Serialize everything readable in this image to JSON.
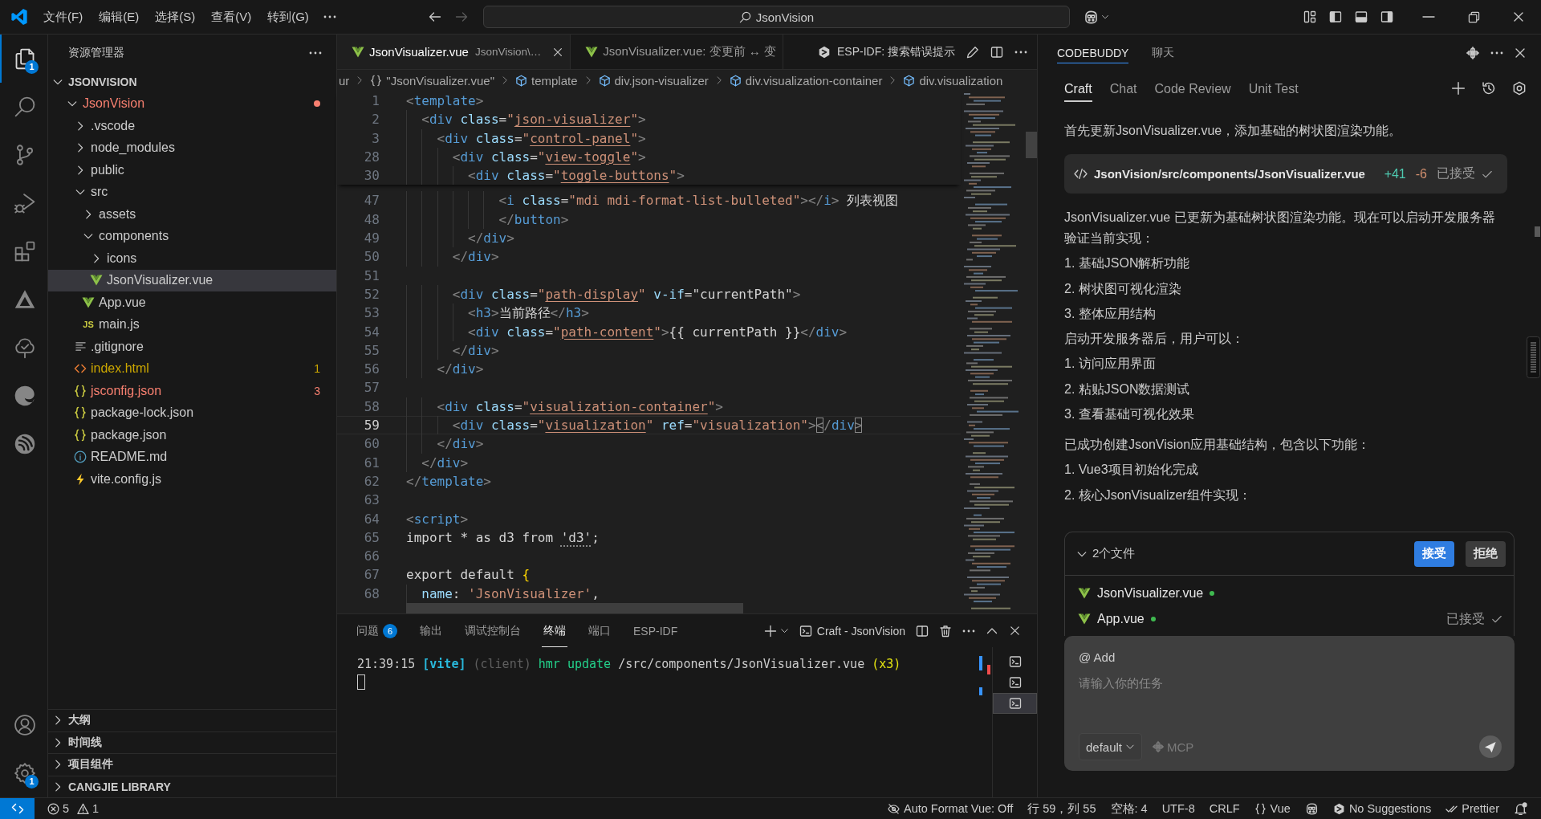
{
  "title_bar": {
    "menus": [
      "文件(F)",
      "编辑(E)",
      "选择(S)",
      "查看(V)",
      "转到(G)"
    ],
    "navigation": [
      {
        "kind": "back",
        "disabled": false
      },
      {
        "kind": "forward",
        "disabled": true
      }
    ],
    "search": {
      "label": "JsonVision"
    }
  },
  "activity_bar": {
    "items": [
      {
        "kind": "explorer",
        "selected": true,
        "badge": "1"
      },
      {
        "kind": "search",
        "selected": false
      },
      {
        "kind": "source-control",
        "selected": false
      },
      {
        "kind": "run-debug",
        "selected": false
      },
      {
        "kind": "extensions",
        "selected": false
      },
      {
        "kind": "triangle",
        "selected": false
      },
      {
        "kind": "tree",
        "selected": false
      },
      {
        "kind": "swirl",
        "selected": false
      },
      {
        "kind": "disc",
        "selected": false
      }
    ],
    "bottom": [
      {
        "kind": "account"
      },
      {
        "kind": "manage",
        "badge": "1"
      }
    ]
  },
  "sidebar": {
    "title": "资源管理器",
    "root": {
      "label": "JSONVISION",
      "expanded": true,
      "children": [
        {
          "label": "JsonVision",
          "kind": "folder",
          "expanded": true,
          "selected": false,
          "color": "#f88070",
          "children": [
            {
              "label": ".vscode",
              "kind": "folder",
              "expanded": false,
              "selected": false
            },
            {
              "label": "node_modules",
              "kind": "folder",
              "expanded": false,
              "selected": false
            },
            {
              "label": "public",
              "kind": "folder",
              "expanded": false,
              "selected": false
            },
            {
              "label": "src",
              "kind": "folder",
              "expanded": true,
              "selected": false,
              "children": [
                {
                  "label": "assets",
                  "kind": "folder",
                  "expanded": false,
                  "selected": false
                },
                {
                  "label": "components",
                  "kind": "folder",
                  "expanded": true,
                  "selected": false,
                  "children": [
                    {
                      "label": "icons",
                      "kind": "folder",
                      "expanded": false,
                      "selected": false
                    },
                    {
                      "label": "JsonVisualizer.vue",
                      "kind": "vue",
                      "selected": true
                    }
                  ]
                },
                {
                  "label": "App.vue",
                  "kind": "vue",
                  "selected": false
                },
                {
                  "label": "main.js",
                  "kind": "js",
                  "icon_text": "JS",
                  "selected": false
                }
              ]
            },
            {
              "label": ".gitignore",
              "kind": "text",
              "selected": false
            },
            {
              "label": "index.html",
              "kind": "html",
              "selected": false,
              "color": "#cca700",
              "badge": "1"
            },
            {
              "label": "jsconfig.json",
              "kind": "json",
              "selected": false,
              "color": "#f88070",
              "badge": "3"
            },
            {
              "label": "package-lock.json",
              "kind": "json",
              "selected": false
            },
            {
              "label": "package.json",
              "kind": "json",
              "selected": false
            },
            {
              "label": "README.md",
              "kind": "info",
              "selected": false
            },
            {
              "label": "vite.config.js",
              "kind": "vite",
              "selected": false
            }
          ]
        }
      ]
    },
    "sections": [
      {
        "label": "大纲",
        "expanded": false
      },
      {
        "label": "时间线",
        "expanded": false
      },
      {
        "label": "项目组件",
        "expanded": false
      },
      {
        "label": "CANGJIE LIBRARY",
        "expanded": false
      }
    ]
  },
  "editor": {
    "tabs": [
      {
        "title": "JsonVisualizer.vue",
        "description": "JsonVision\\…",
        "selected": true
      },
      {
        "title": "JsonVisualizer.vue: 变更前 ↔ 变",
        "selected": false
      }
    ],
    "actions": [
      {
        "kind": "hexagon",
        "label": "ESP-IDF: 搜索错误提示"
      },
      {
        "kind": "pencil"
      },
      {
        "kind": "split"
      },
      {
        "kind": "more"
      }
    ],
    "breadcrumbs": [
      {
        "kind": "text",
        "text": "ur"
      },
      {
        "kind": "file",
        "text": "\"JsonVisualizer.vue\""
      },
      {
        "kind": "element",
        "text": "template"
      },
      {
        "kind": "element",
        "text": "div.json-visualizer"
      },
      {
        "kind": "element",
        "text": "div.visualization-container"
      },
      {
        "kind": "element",
        "text": "div.visualization"
      }
    ],
    "sticky_lines": [
      {
        "n": "1",
        "tokens": [
          {
            "kind": "bracket",
            "text": "<"
          },
          {
            "kind": "tag",
            "text": "template"
          },
          {
            "kind": "bracket",
            "text": ">"
          }
        ]
      },
      {
        "n": "2",
        "tokens": [
          {
            "kind": "bracket",
            "text": "  <"
          },
          {
            "kind": "tag",
            "text": "div"
          },
          {
            "kind": "attr",
            "text": " class"
          },
          {
            "kind": "equals",
            "text": "="
          },
          {
            "kind": "string",
            "text": "\""
          },
          {
            "kind": "class",
            "text": "json-visualizer"
          },
          {
            "kind": "string",
            "text": "\""
          },
          {
            "kind": "bracket",
            "text": ">"
          }
        ]
      },
      {
        "n": "3",
        "tokens": [
          {
            "kind": "bracket",
            "text": "    <"
          },
          {
            "kind": "tag",
            "text": "div"
          },
          {
            "kind": "attr",
            "text": " class"
          },
          {
            "kind": "equals",
            "text": "="
          },
          {
            "kind": "string",
            "text": "\""
          },
          {
            "kind": "class",
            "text": "control-panel"
          },
          {
            "kind": "string",
            "text": "\""
          },
          {
            "kind": "bracket",
            "text": ">"
          }
        ]
      },
      {
        "n": "28",
        "tokens": [
          {
            "kind": "bracket",
            "text": "      <"
          },
          {
            "kind": "tag",
            "text": "div"
          },
          {
            "kind": "attr",
            "text": " class"
          },
          {
            "kind": "equals",
            "text": "="
          },
          {
            "kind": "string",
            "text": "\""
          },
          {
            "kind": "class",
            "text": "view-toggle"
          },
          {
            "kind": "string",
            "text": "\""
          },
          {
            "kind": "bracket",
            "text": ">"
          }
        ]
      },
      {
        "n": "30",
        "tokens": [
          {
            "kind": "bracket",
            "text": "        <"
          },
          {
            "kind": "tag",
            "text": "div"
          },
          {
            "kind": "attr",
            "text": " class"
          },
          {
            "kind": "equals",
            "text": "="
          },
          {
            "kind": "string",
            "text": "\""
          },
          {
            "kind": "class",
            "text": "toggle-buttons"
          },
          {
            "kind": "string",
            "text": "\""
          },
          {
            "kind": "bracket",
            "text": ">"
          }
        ]
      }
    ],
    "lines": [
      {
        "n": "47",
        "current": false,
        "tokens": [
          {
            "kind": "bracket",
            "text": "            <"
          },
          {
            "kind": "tag",
            "text": "i"
          },
          {
            "kind": "attr",
            "text": " class"
          },
          {
            "kind": "equals",
            "text": "="
          },
          {
            "kind": "string",
            "text": "\"mdi mdi-format-list-bulleted\""
          },
          {
            "kind": "bracket",
            "text": "></"
          },
          {
            "kind": "tag",
            "text": "i"
          },
          {
            "kind": "bracket",
            "text": ">"
          },
          {
            "kind": "text",
            "text": " 列表视图"
          }
        ]
      },
      {
        "n": "48",
        "current": false,
        "tokens": [
          {
            "kind": "bracket",
            "text": "            </"
          },
          {
            "kind": "tag",
            "text": "button"
          },
          {
            "kind": "bracket",
            "text": ">"
          }
        ]
      },
      {
        "n": "49",
        "current": false,
        "tokens": [
          {
            "kind": "bracket",
            "text": "        </"
          },
          {
            "kind": "tag",
            "text": "div"
          },
          {
            "kind": "bracket",
            "text": ">"
          }
        ]
      },
      {
        "n": "50",
        "current": false,
        "tokens": [
          {
            "kind": "bracket",
            "text": "      </"
          },
          {
            "kind": "tag",
            "text": "div"
          },
          {
            "kind": "bracket",
            "text": ">"
          }
        ]
      },
      {
        "n": "51",
        "current": false
      },
      {
        "n": "52",
        "current": false,
        "tokens": [
          {
            "kind": "bracket",
            "text": "      <"
          },
          {
            "kind": "tag",
            "text": "div"
          },
          {
            "kind": "attr",
            "text": " class"
          },
          {
            "kind": "equals",
            "text": "="
          },
          {
            "kind": "string",
            "text": "\""
          },
          {
            "kind": "class",
            "text": "path-display"
          },
          {
            "kind": "string",
            "text": "\""
          },
          {
            "kind": "attr",
            "text": " v-if"
          },
          {
            "kind": "equals",
            "text": "="
          },
          {
            "kind": "text",
            "text": "\"currentPath\""
          },
          {
            "kind": "bracket",
            "text": ">"
          }
        ]
      },
      {
        "n": "53",
        "current": false,
        "tokens": [
          {
            "kind": "bracket",
            "text": "        <"
          },
          {
            "kind": "tag",
            "text": "h3"
          },
          {
            "kind": "bracket",
            "text": ">"
          },
          {
            "kind": "text",
            "text": "当前路径"
          },
          {
            "kind": "bracket",
            "text": "</"
          },
          {
            "kind": "tag",
            "text": "h3"
          },
          {
            "kind": "bracket",
            "text": ">"
          }
        ]
      },
      {
        "n": "54",
        "current": false,
        "tokens": [
          {
            "kind": "bracket",
            "text": "        <"
          },
          {
            "kind": "tag",
            "text": "div"
          },
          {
            "kind": "attr",
            "text": " class"
          },
          {
            "kind": "equals",
            "text": "="
          },
          {
            "kind": "string",
            "text": "\""
          },
          {
            "kind": "class",
            "text": "path-content"
          },
          {
            "kind": "string",
            "text": "\""
          },
          {
            "kind": "bracket",
            "text": ">"
          },
          {
            "kind": "text",
            "text": "{{ currentPath }}"
          },
          {
            "kind": "bracket",
            "text": "</"
          },
          {
            "kind": "tag",
            "text": "div"
          },
          {
            "kind": "bracket",
            "text": ">"
          }
        ]
      },
      {
        "n": "55",
        "current": false,
        "tokens": [
          {
            "kind": "bracket",
            "text": "      </"
          },
          {
            "kind": "tag",
            "text": "div"
          },
          {
            "kind": "bracket",
            "text": ">"
          }
        ]
      },
      {
        "n": "56",
        "current": false,
        "tokens": [
          {
            "kind": "bracket",
            "text": "    </"
          },
          {
            "kind": "tag",
            "text": "div"
          },
          {
            "kind": "bracket",
            "text": ">"
          }
        ]
      },
      {
        "n": "57",
        "current": false
      },
      {
        "n": "58",
        "current": false,
        "tokens": [
          {
            "kind": "bracket",
            "text": "    <"
          },
          {
            "kind": "tag",
            "text": "div"
          },
          {
            "kind": "attr",
            "text": " class"
          },
          {
            "kind": "equals",
            "text": "="
          },
          {
            "kind": "string",
            "text": "\""
          },
          {
            "kind": "class",
            "text": "visualization-container"
          },
          {
            "kind": "string",
            "text": "\""
          },
          {
            "kind": "bracket",
            "text": ">"
          }
        ]
      },
      {
        "n": "59",
        "current": true,
        "tokens": [
          {
            "kind": "bracket",
            "text": "      <"
          },
          {
            "kind": "tag",
            "text": "div"
          },
          {
            "kind": "attr",
            "text": " class"
          },
          {
            "kind": "equals",
            "text": "="
          },
          {
            "kind": "string",
            "text": "\""
          },
          {
            "kind": "class",
            "text": "visualization"
          },
          {
            "kind": "string",
            "text": "\""
          },
          {
            "kind": "attr",
            "text": " ref"
          },
          {
            "kind": "equals",
            "text": "="
          },
          {
            "kind": "string",
            "text": "\"visualization\""
          },
          {
            "kind": "bracket",
            "text": ">"
          },
          {
            "kind": "match",
            "text": "<"
          },
          {
            "kind": "bracket",
            "text": "/"
          },
          {
            "kind": "tag",
            "text": "div"
          },
          {
            "kind": "match",
            "text": ">"
          }
        ]
      },
      {
        "n": "60",
        "current": false,
        "tokens": [
          {
            "kind": "bracket",
            "text": "    </"
          },
          {
            "kind": "tag",
            "text": "div"
          },
          {
            "kind": "bracket",
            "text": ">"
          }
        ]
      },
      {
        "n": "61",
        "current": false,
        "tokens": [
          {
            "kind": "bracket",
            "text": "  </"
          },
          {
            "kind": "tag",
            "text": "div"
          },
          {
            "kind": "bracket",
            "text": ">"
          }
        ]
      },
      {
        "n": "62",
        "current": false,
        "tokens": [
          {
            "kind": "bracket",
            "text": "</"
          },
          {
            "kind": "tag",
            "text": "template"
          },
          {
            "kind": "bracket",
            "text": ">"
          }
        ]
      },
      {
        "n": "63",
        "current": false
      },
      {
        "n": "64",
        "current": false,
        "tokens": [
          {
            "kind": "bracket",
            "text": "<"
          },
          {
            "kind": "tag",
            "text": "script"
          },
          {
            "kind": "bracket",
            "text": ">"
          }
        ]
      },
      {
        "n": "65",
        "current": false,
        "tokens": [
          {
            "kind": "text",
            "text": "import * as d3 from "
          },
          {
            "kind": "hint",
            "text": "'d3'"
          },
          {
            "kind": "text",
            "text": ";"
          }
        ]
      },
      {
        "n": "66",
        "current": false
      },
      {
        "n": "67",
        "current": false,
        "tokens": [
          {
            "kind": "text",
            "text": "export default "
          },
          {
            "kind": "brace",
            "text": "{"
          }
        ]
      },
      {
        "n": "68",
        "current": false,
        "tokens": [
          {
            "kind": "variable",
            "text": "  name"
          },
          {
            "kind": "text",
            "text": ": "
          },
          {
            "kind": "string",
            "text": "'JsonVisualizer'"
          },
          {
            "kind": "text",
            "text": ","
          }
        ]
      }
    ]
  },
  "panel": {
    "tabs": [
      {
        "label": "问题",
        "badge": "6",
        "selected": false
      },
      {
        "label": "输出",
        "selected": false
      },
      {
        "label": "调试控制台",
        "selected": false
      },
      {
        "label": "终端",
        "selected": true
      },
      {
        "label": "端口",
        "selected": false
      },
      {
        "label": "ESP-IDF",
        "selected": false
      }
    ],
    "terminal": {
      "name": "Craft - JsonVision",
      "output": [
        {
          "kind": "time",
          "text": "21:39:15"
        },
        {
          "kind": "source",
          "text": "[vite]"
        },
        {
          "kind": "dim",
          "text": "(client)"
        },
        {
          "kind": "action",
          "text": "hmr update"
        },
        {
          "kind": "path",
          "text": "/src/components/JsonVisualizer.vue"
        },
        {
          "kind": "count",
          "text": "(x3)"
        }
      ],
      "instances": [
        {
          "selected": false
        },
        {
          "selected": false
        },
        {
          "selected": true
        }
      ]
    }
  },
  "assistant": {
    "tabs": [
      {
        "label": "CODEBUDDY",
        "selected": true
      },
      {
        "label": "聊天",
        "selected": false
      }
    ],
    "modes": [
      {
        "label": "Craft",
        "selected": true
      },
      {
        "label": "Chat",
        "selected": false
      },
      {
        "label": "Code Review",
        "selected": false
      },
      {
        "label": "Unit Test",
        "selected": false
      }
    ],
    "messages": [
      {
        "kind": "text",
        "lines": [
          "首先更新JsonVisualizer.vue，添加基础的树状图渲染功能。"
        ]
      },
      {
        "kind": "file",
        "path": "JsonVision/src/components/JsonVisualizer.vue",
        "added": "+41",
        "removed": "-6",
        "status": "已接受"
      },
      {
        "kind": "text",
        "lines": [
          "JsonVisualizer.vue 已更新为基础树状图渲染功能。现在可以启动开发服务器验证当前实现：",
          "1. 基础JSON解析功能",
          "2. 树状图可视化渲染",
          "3. 整体应用结构",
          "启动开发服务器后，用户可以：",
          "1. 访问应用界面",
          "2. 粘贴JSON数据测试",
          "3. 查看基础可视化效果"
        ]
      },
      {
        "kind": "text",
        "lines": [
          "已成功创建JsonVision应用基础结构，包含以下功能：",
          "1. Vue3项目初始化完成",
          "2. 核心JsonVisualizer组件实现："
        ]
      }
    ],
    "changes": {
      "title": "2个文件",
      "expanded": true,
      "accept": "接受",
      "reject": "拒绝",
      "files": [
        {
          "name": "JsonVisualizer.vue"
        },
        {
          "name": "App.vue",
          "status": "已接受"
        }
      ]
    },
    "composer": {
      "context": "@ Add",
      "placeholder": "请输入你的任务",
      "model": "default",
      "tool": "MCP"
    }
  },
  "status_bar": {
    "problems": {
      "errors": "5",
      "warnings": "1"
    },
    "items": [
      {
        "kind": "eye-off",
        "text": "Auto Format Vue: Off"
      },
      {
        "kind": "text",
        "text": "行 59，列 55"
      },
      {
        "kind": "text",
        "text": "空格: 4"
      },
      {
        "kind": "text",
        "text": "UTF-8"
      },
      {
        "kind": "text",
        "text": "CRLF"
      },
      {
        "kind": "braces",
        "text": "Vue"
      },
      {
        "kind": "bot"
      },
      {
        "kind": "hexagon",
        "text": "No Suggestions"
      },
      {
        "kind": "double-check",
        "text": "Prettier"
      },
      {
        "kind": "bell"
      }
    ]
  }
}
